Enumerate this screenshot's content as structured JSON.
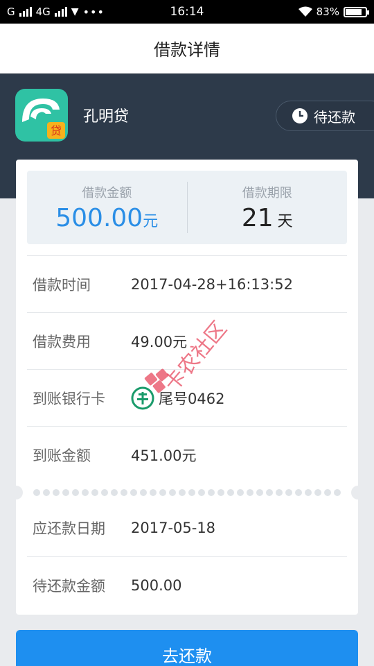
{
  "status_bar": {
    "carrier1": "G",
    "network": "4G",
    "time": "16:14",
    "battery": "83%",
    "battery_level": 0.83
  },
  "nav": {
    "title": "借款详情"
  },
  "header": {
    "app_name": "孔明贷",
    "logo_badge": "贷",
    "status": "待还款"
  },
  "summary": {
    "amount_label": "借款金额",
    "amount_value": "500.00",
    "amount_unit": "元",
    "term_label": "借款期限",
    "term_value": "21",
    "term_unit": "天"
  },
  "details": [
    {
      "label": "借款时间",
      "value": "2017-04-28+16:13:52"
    },
    {
      "label": "借款费用",
      "value": "49.00元"
    },
    {
      "label": "到账银行卡",
      "value": "尾号0462"
    },
    {
      "label": "到账金额",
      "value": "451.00元"
    },
    {
      "label": "应还款日期",
      "value": "2017-05-18"
    },
    {
      "label": "待还款金额",
      "value": "500.00"
    }
  ],
  "watermark": {
    "text": "卡农社区"
  },
  "pay_button": {
    "label": "去还款"
  },
  "colors": {
    "accent": "#1e8ff0",
    "header_bg": "#2d3a4a",
    "logo_green": "#2fc2a4",
    "bank_green": "#1a9b6b"
  }
}
